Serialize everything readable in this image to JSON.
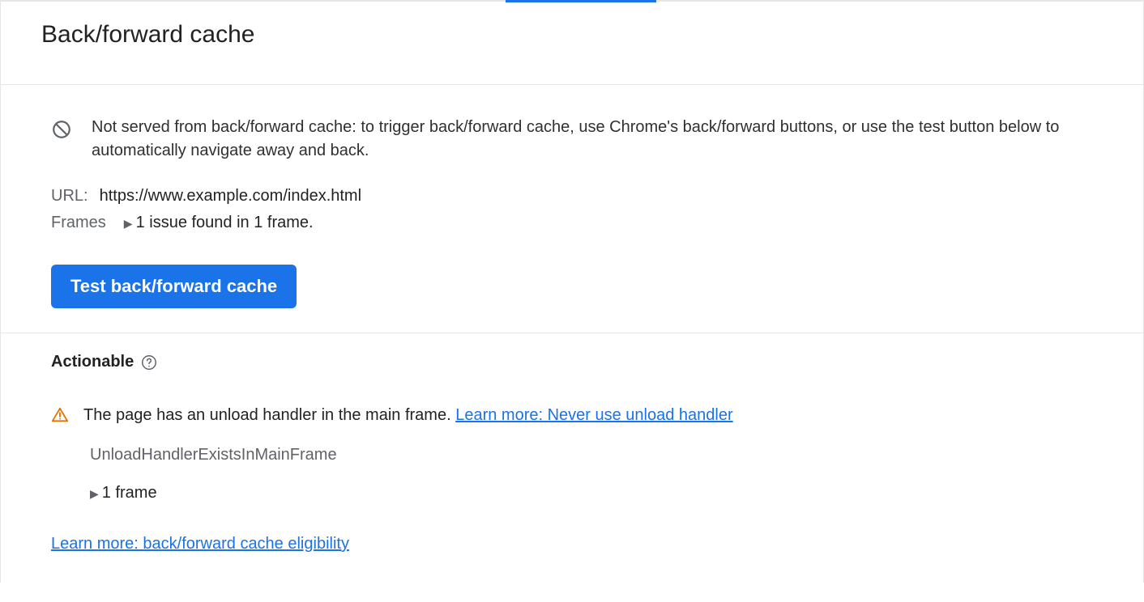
{
  "header": {
    "title": "Back/forward cache"
  },
  "info": {
    "message": "Not served from back/forward cache: to trigger back/forward cache, use Chrome's back/forward buttons, or use the test button below to automatically navigate away and back."
  },
  "url": {
    "label": "URL:",
    "value": "https://www.example.com/index.html"
  },
  "frames": {
    "label": "Frames",
    "summary": "1 issue found in 1 frame."
  },
  "button": {
    "test_label": "Test back/forward cache"
  },
  "actionable": {
    "heading": "Actionable",
    "issue_text": "The page has an unload handler in the main frame. ",
    "learn_more_label": "Learn more: Never use unload handler",
    "issue_code": "UnloadHandlerExistsInMainFrame",
    "frame_count_label": "1 frame"
  },
  "bottom_link": {
    "label": "Learn more: back/forward cache eligibility"
  }
}
